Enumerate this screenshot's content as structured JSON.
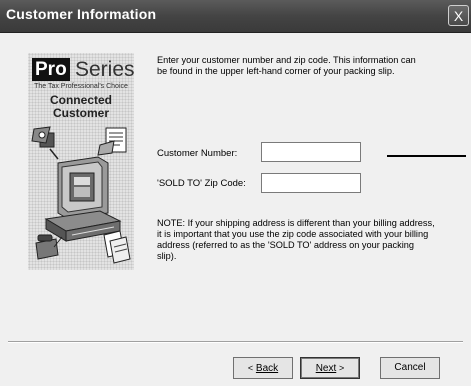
{
  "window": {
    "title": "Customer Information",
    "close_label": "X"
  },
  "sidebar": {
    "logo_bold": "Pro",
    "logo_rest": "Series",
    "tagline": "The Tax Professional's Choice",
    "line1": "Connected",
    "line2": "Customer"
  },
  "intro_text": "Enter your customer number and zip code.  This information can be found in the upper left-hand corner of your packing slip.",
  "form": {
    "customer_number_label": "Customer Number:",
    "customer_number_value": "",
    "zip_label": "'SOLD TO' Zip Code:",
    "zip_value": ""
  },
  "note_text": "NOTE:  If your shipping address is different than your billing address, it is important that you use the zip code associated with your billing address (referred to as the 'SOLD TO' address on your packing slip).",
  "buttons": {
    "back_arrow": "<",
    "back": "Back",
    "next": "Next",
    "next_arrow": ">",
    "cancel": "Cancel"
  }
}
